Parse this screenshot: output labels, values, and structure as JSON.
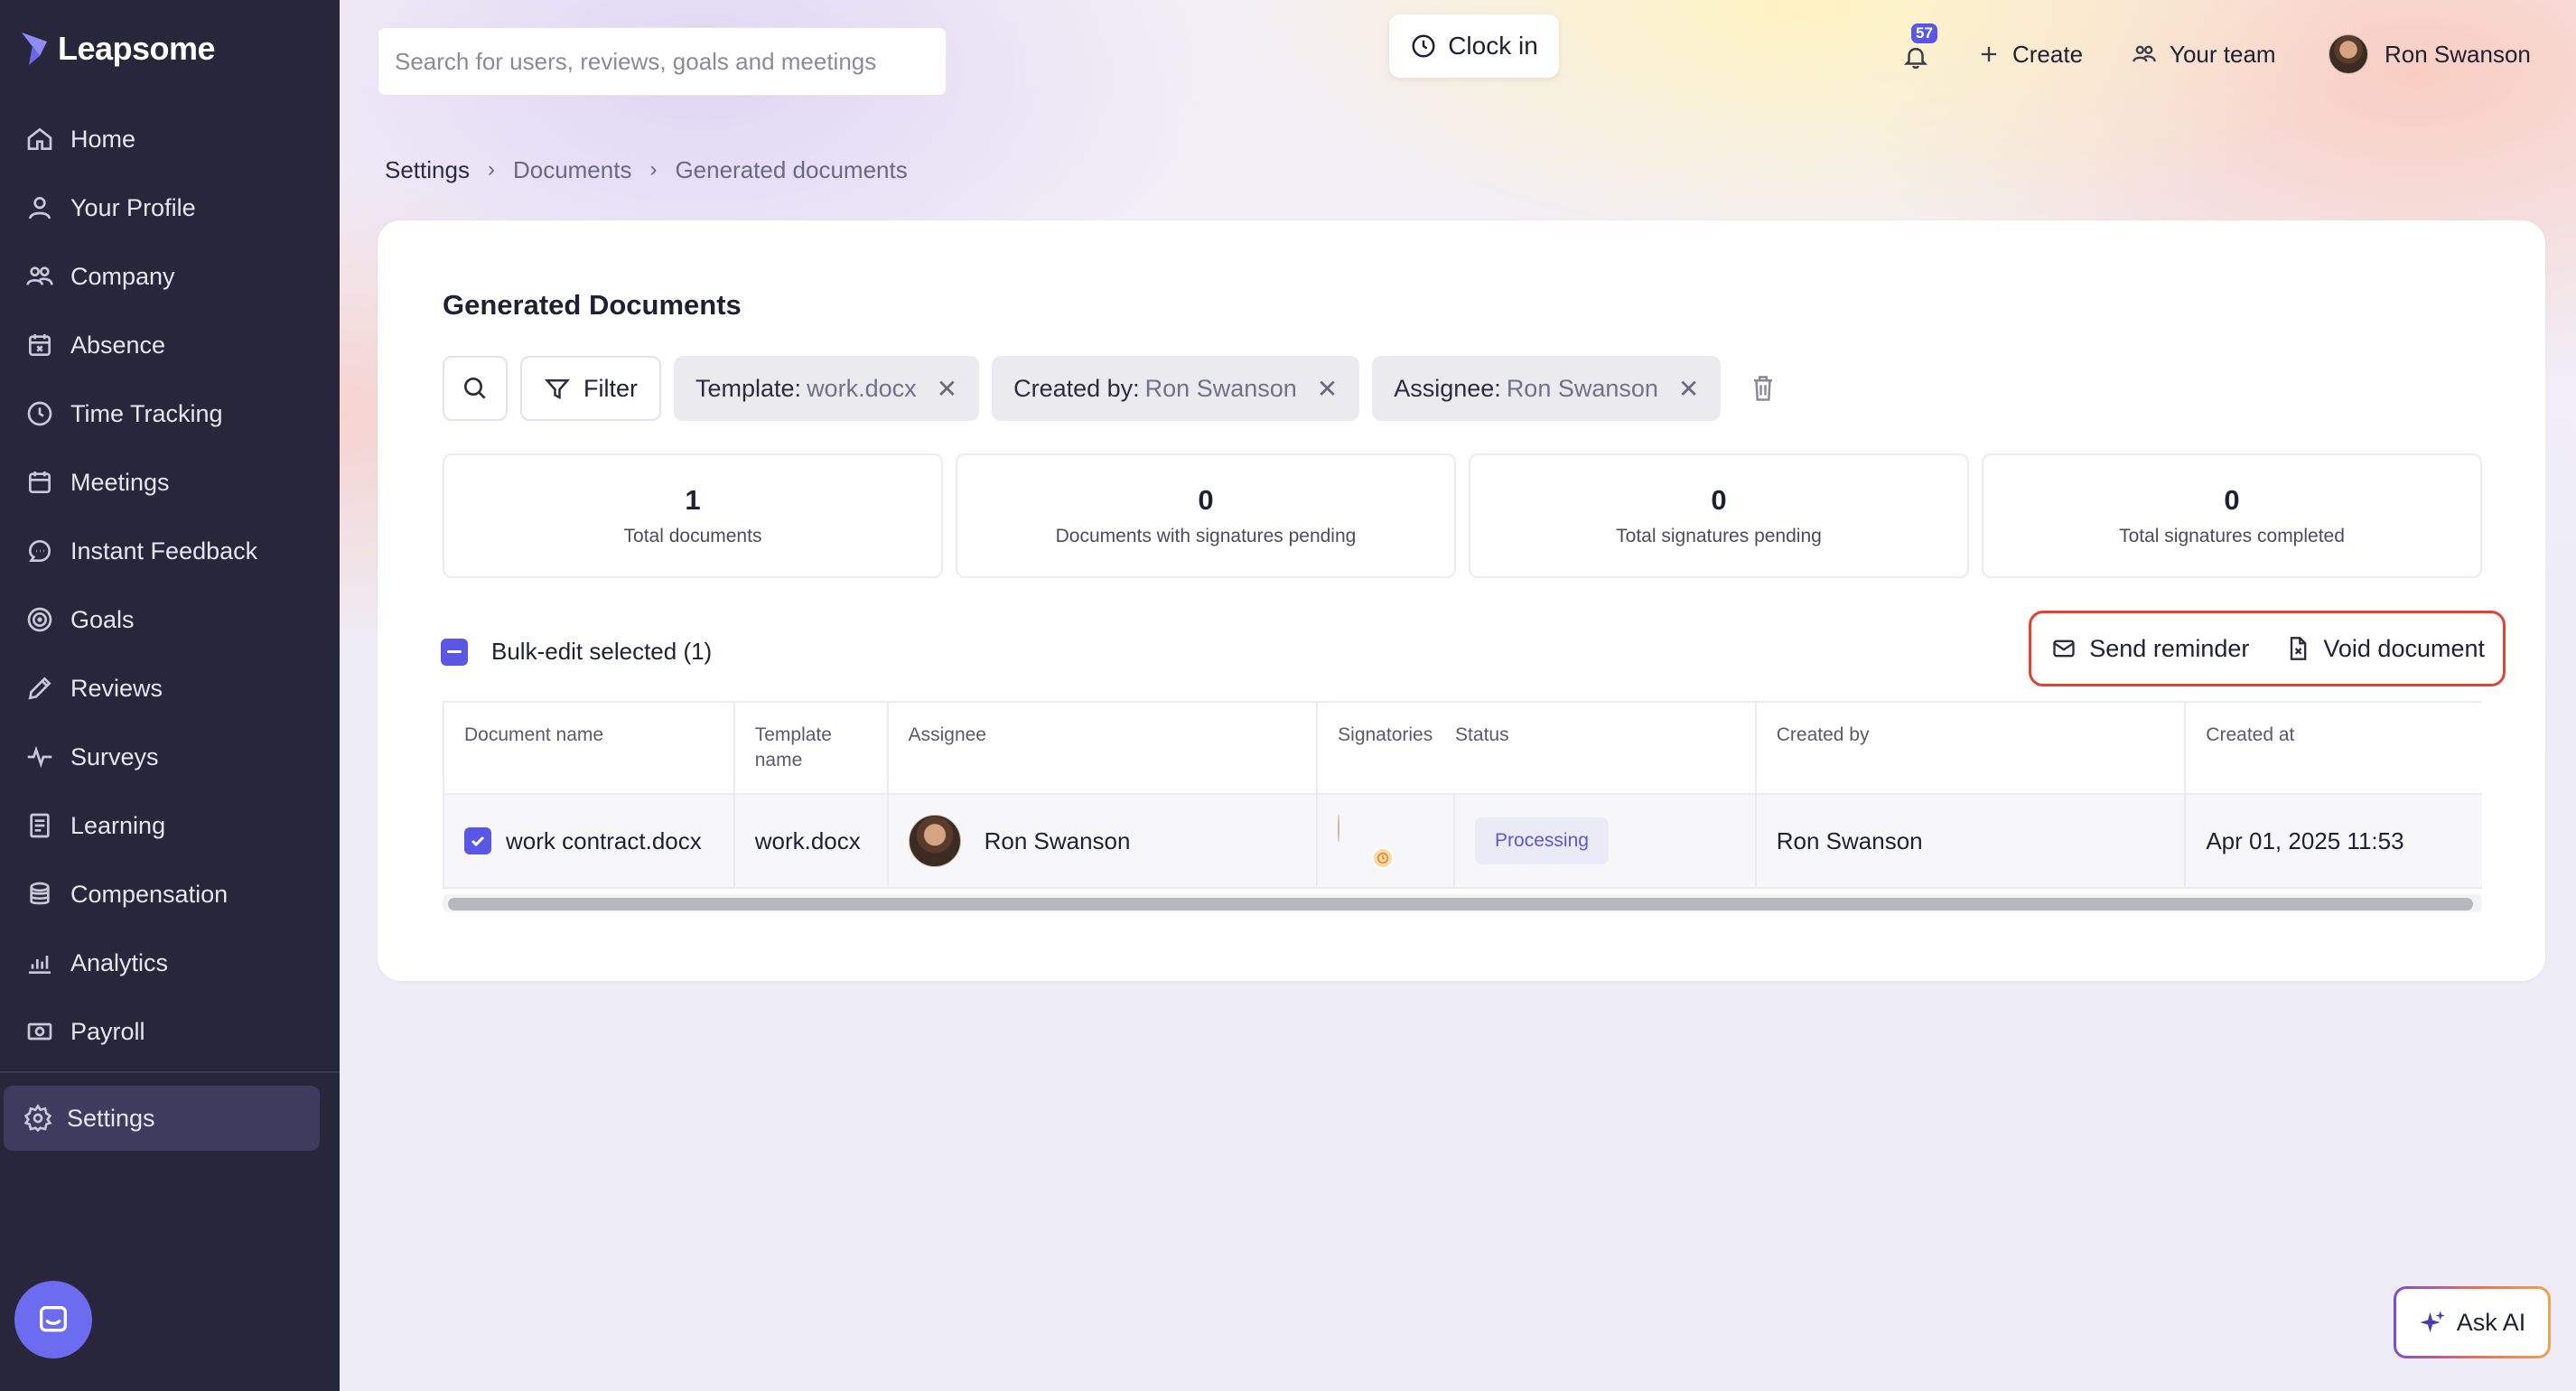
{
  "app": {
    "brand": "Leapsome",
    "accent_color": "#5a57e6",
    "sidebar_color": "#27263b",
    "highlight_color": "#e5412f"
  },
  "sidebar": {
    "items": [
      {
        "label": "Home",
        "icon": "home-icon"
      },
      {
        "label": "Your Profile",
        "icon": "user-icon"
      },
      {
        "label": "Company",
        "icon": "users-icon"
      },
      {
        "label": "Absence",
        "icon": "calendar-x-icon"
      },
      {
        "label": "Time Tracking",
        "icon": "clock-icon"
      },
      {
        "label": "Meetings",
        "icon": "calendar-icon"
      },
      {
        "label": "Instant Feedback",
        "icon": "message-icon"
      },
      {
        "label": "Goals",
        "icon": "target-icon"
      },
      {
        "label": "Reviews",
        "icon": "pencil-icon"
      },
      {
        "label": "Surveys",
        "icon": "pulse-icon"
      },
      {
        "label": "Learning",
        "icon": "book-icon"
      },
      {
        "label": "Compensation",
        "icon": "coins-icon"
      },
      {
        "label": "Analytics",
        "icon": "chart-icon"
      },
      {
        "label": "Payroll",
        "icon": "money-icon"
      }
    ],
    "settings_label": "Settings"
  },
  "topbar": {
    "search_placeholder": "Search for users, reviews, goals and meetings",
    "clock_in_label": "Clock in",
    "notification_count": "57",
    "create_label": "Create",
    "team_label": "Your team",
    "user_name": "Ron Swanson"
  },
  "breadcrumb": {
    "items": [
      "Settings",
      "Documents",
      "Generated documents"
    ]
  },
  "page": {
    "title": "Generated Documents",
    "filter_label": "Filter",
    "chips": [
      {
        "key": "Template:",
        "value": "work.docx"
      },
      {
        "key": "Created by:",
        "value": "Ron Swanson"
      },
      {
        "key": "Assignee:",
        "value": "Ron Swanson"
      }
    ],
    "stats": [
      {
        "value": "1",
        "label": "Total documents"
      },
      {
        "value": "0",
        "label": "Documents with signatures pending"
      },
      {
        "value": "0",
        "label": "Total signatures pending"
      },
      {
        "value": "0",
        "label": "Total signatures completed"
      }
    ],
    "bulk_label": "Bulk-edit selected (1)",
    "actions": {
      "send_reminder": "Send reminder",
      "void_document": "Void document"
    },
    "table": {
      "headers": [
        "Document name",
        "Template name",
        "Assignee",
        "Signatories",
        "Status",
        "Created by",
        "Created at"
      ],
      "rows": [
        {
          "document_name": "work contract.docx",
          "template_name": "work.docx",
          "assignee": "Ron Swanson",
          "status": "Processing",
          "created_by": "Ron Swanson",
          "created_at": "Apr 01, 2025 11:53",
          "selected": true
        }
      ]
    }
  },
  "ask_ai_label": "Ask AI"
}
